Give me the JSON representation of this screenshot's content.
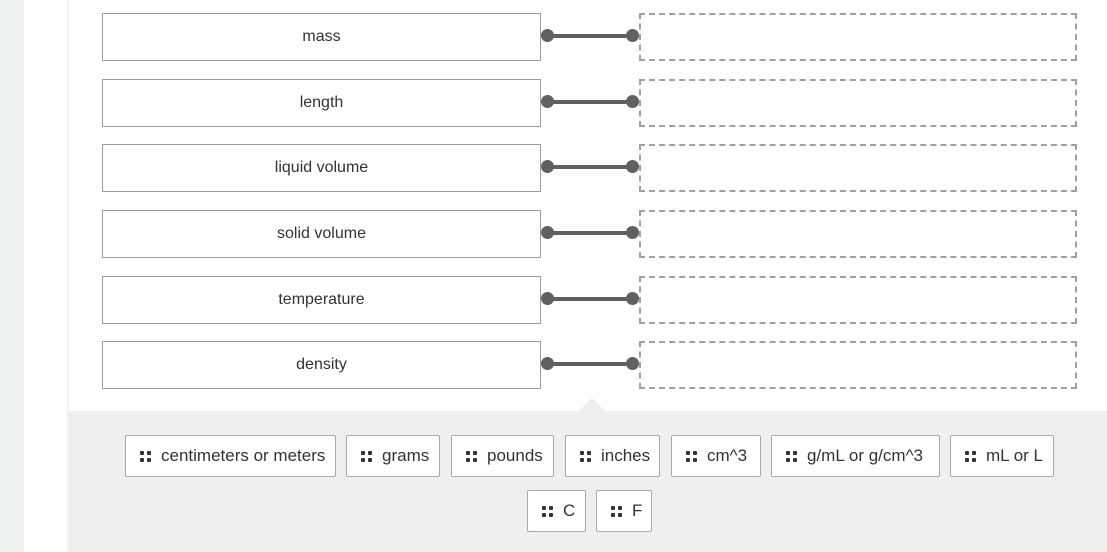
{
  "matching": {
    "terms": [
      {
        "label": "mass"
      },
      {
        "label": "length"
      },
      {
        "label": "liquid volume"
      },
      {
        "label": "solid volume"
      },
      {
        "label": "temperature"
      },
      {
        "label": "density"
      }
    ],
    "dropzones_filled": [
      null,
      null,
      null,
      null,
      null,
      null
    ]
  },
  "answer_bank": {
    "chips": [
      {
        "label": "centimeters or meters",
        "icon": "drag-handle-icon"
      },
      {
        "label": "grams",
        "icon": "drag-handle-icon"
      },
      {
        "label": "pounds",
        "icon": "drag-handle-icon"
      },
      {
        "label": "inches",
        "icon": "drag-handle-icon"
      },
      {
        "label": "cm^3",
        "icon": "drag-handle-icon"
      },
      {
        "label": "g/mL or g/cm^3",
        "icon": "drag-handle-icon"
      },
      {
        "label": "mL or L",
        "icon": "drag-handle-icon"
      },
      {
        "label": "C",
        "icon": "drag-handle-icon"
      },
      {
        "label": "F",
        "icon": "drag-handle-icon"
      }
    ]
  },
  "colors": {
    "connector": "#606060",
    "bank_background": "#efefef",
    "dropzone_border": "#a0a0a0"
  }
}
